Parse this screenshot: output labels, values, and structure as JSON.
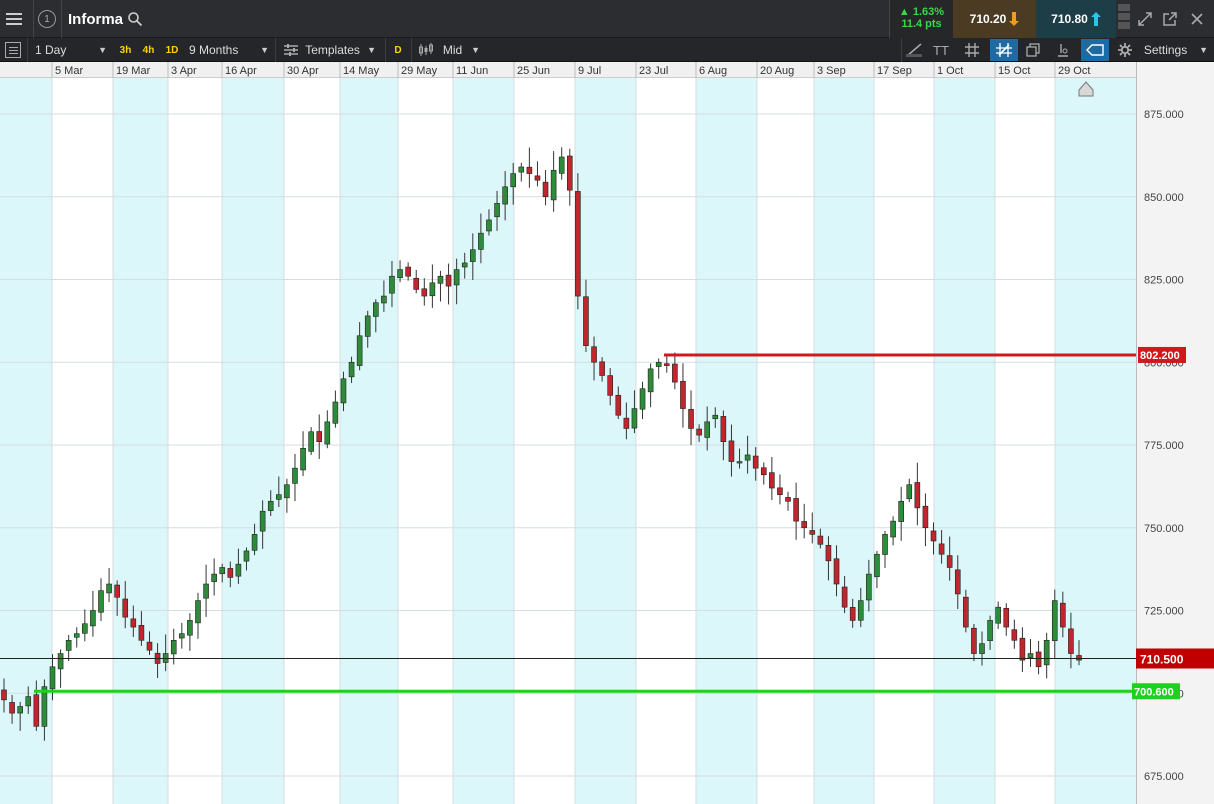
{
  "header": {
    "symbol": "Informa",
    "change_pct": "▲ 1.63%",
    "change_pts": "11.4 pts",
    "sell_price": "710.20",
    "buy_price": "710.80",
    "info_glyph": "1"
  },
  "toolbar": {
    "interval": "1 Day",
    "btn_3h": "3h",
    "btn_4h": "4h",
    "btn_1d": "1D",
    "range": "9 Months",
    "templates": "Templates",
    "btn_d": "D",
    "price_type": "Mid",
    "settings": "Settings",
    "text_tool": "TT"
  },
  "colors": {
    "up": "#2e8b3a",
    "down": "#c0262d",
    "resistance": "#d0191c",
    "support": "#1fd01f",
    "current": "#c00000"
  },
  "chart_data": {
    "type": "candlestick",
    "x_ticks": [
      "5 Mar",
      "19 Mar",
      "3 Apr",
      "16 Apr",
      "30 Apr",
      "14 May",
      "29 May",
      "11 Jun",
      "25 Jun",
      "9 Jul",
      "23 Jul",
      "6 Aug",
      "20 Aug",
      "3 Sep",
      "17 Sep",
      "1 Oct",
      "15 Oct",
      "29 Oct"
    ],
    "y_ticks": [
      "875.000",
      "850.000",
      "825.000",
      "800.000",
      "775.000",
      "750.000",
      "725.000",
      "700.000",
      "675.000"
    ],
    "ylim": [
      672,
      888
    ],
    "key_levels": {
      "resistance": "802.200",
      "current": "710.500",
      "support": "700.600"
    },
    "closes": [
      698,
      694,
      696,
      699,
      690,
      702,
      708,
      712,
      716,
      718,
      721,
      725,
      731,
      733,
      729,
      723,
      720,
      716,
      713,
      709,
      712,
      716,
      718,
      722,
      728,
      733,
      736,
      738,
      735,
      739,
      743,
      748,
      755,
      758,
      760,
      763,
      768,
      774,
      779,
      776,
      782,
      788,
      795,
      800,
      808,
      814,
      818,
      820,
      826,
      828,
      826,
      822,
      820,
      824,
      826,
      823,
      828,
      830,
      834,
      839,
      843,
      848,
      853,
      857,
      859,
      857,
      855,
      850,
      858,
      862,
      852,
      820,
      805,
      800,
      796,
      790,
      784,
      780,
      786,
      792,
      798,
      800,
      799,
      794,
      786,
      780,
      778,
      782,
      784,
      776,
      770,
      770,
      772,
      768,
      766,
      762,
      760,
      758,
      752,
      750,
      748,
      745,
      740,
      733,
      726,
      722,
      728,
      736,
      742,
      748,
      752,
      758,
      763,
      756,
      750,
      746,
      742,
      738,
      730,
      720,
      712,
      715,
      722,
      726,
      720,
      716,
      710,
      712,
      708,
      716,
      728,
      720,
      712,
      710
    ],
    "opens_from_prev": true
  }
}
